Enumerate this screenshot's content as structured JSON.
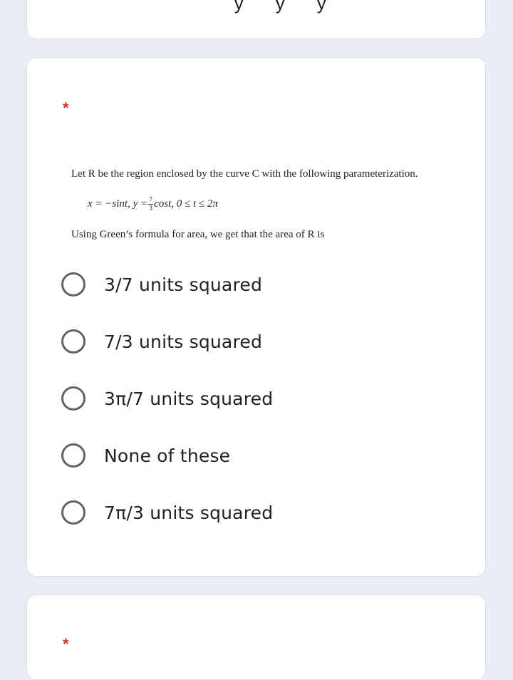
{
  "previous_card": {
    "cut_text": "` ` y ` ` y ` ` y"
  },
  "question": {
    "required_mark": "*",
    "line1": "Let R be the region enclosed by the curve C with the following parameterization.",
    "formula": {
      "part1": "x = −sint, y = ",
      "frac_num": "7",
      "frac_den": "3",
      "part2": "cost, 0 ≤ t ≤ 2π"
    },
    "line3": "Using Green’s formula for area, we get that the area of R is",
    "options": [
      {
        "label": "3/7 units squared"
      },
      {
        "label": "7/3 units squared"
      },
      {
        "label": "3π/7 units squared"
      },
      {
        "label": "None of these"
      },
      {
        "label": "7π/3 units squared"
      }
    ]
  },
  "next_card": {
    "required_mark": "*"
  },
  "colors": {
    "background": "#eaedf6",
    "card": "#ffffff",
    "required": "#d93025",
    "radio_border": "#5f6368",
    "text": "#202124"
  }
}
